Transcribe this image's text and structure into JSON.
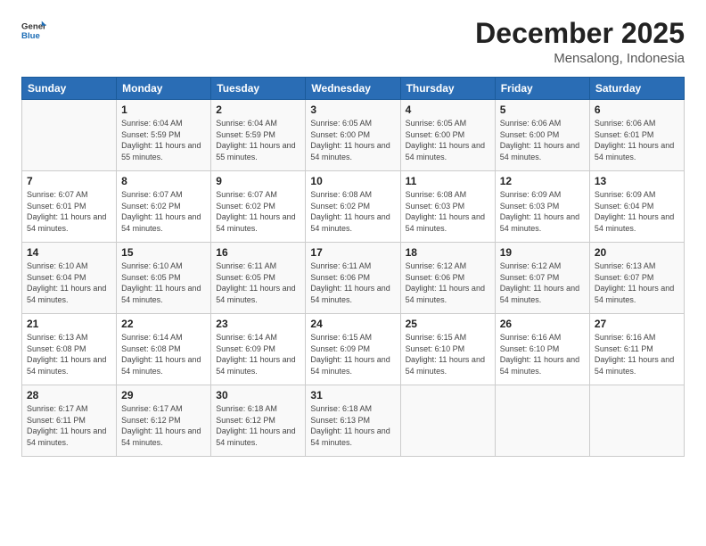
{
  "header": {
    "logo_line1": "General",
    "logo_line2": "Blue",
    "month_year": "December 2025",
    "location": "Mensalong, Indonesia"
  },
  "days_of_week": [
    "Sunday",
    "Monday",
    "Tuesday",
    "Wednesday",
    "Thursday",
    "Friday",
    "Saturday"
  ],
  "weeks": [
    [
      {
        "day": "",
        "sunrise": "",
        "sunset": "",
        "daylight": ""
      },
      {
        "day": "1",
        "sunrise": "Sunrise: 6:04 AM",
        "sunset": "Sunset: 5:59 PM",
        "daylight": "Daylight: 11 hours and 55 minutes."
      },
      {
        "day": "2",
        "sunrise": "Sunrise: 6:04 AM",
        "sunset": "Sunset: 5:59 PM",
        "daylight": "Daylight: 11 hours and 55 minutes."
      },
      {
        "day": "3",
        "sunrise": "Sunrise: 6:05 AM",
        "sunset": "Sunset: 6:00 PM",
        "daylight": "Daylight: 11 hours and 54 minutes."
      },
      {
        "day": "4",
        "sunrise": "Sunrise: 6:05 AM",
        "sunset": "Sunset: 6:00 PM",
        "daylight": "Daylight: 11 hours and 54 minutes."
      },
      {
        "day": "5",
        "sunrise": "Sunrise: 6:06 AM",
        "sunset": "Sunset: 6:00 PM",
        "daylight": "Daylight: 11 hours and 54 minutes."
      },
      {
        "day": "6",
        "sunrise": "Sunrise: 6:06 AM",
        "sunset": "Sunset: 6:01 PM",
        "daylight": "Daylight: 11 hours and 54 minutes."
      }
    ],
    [
      {
        "day": "7",
        "sunrise": "Sunrise: 6:07 AM",
        "sunset": "Sunset: 6:01 PM",
        "daylight": "Daylight: 11 hours and 54 minutes."
      },
      {
        "day": "8",
        "sunrise": "Sunrise: 6:07 AM",
        "sunset": "Sunset: 6:02 PM",
        "daylight": "Daylight: 11 hours and 54 minutes."
      },
      {
        "day": "9",
        "sunrise": "Sunrise: 6:07 AM",
        "sunset": "Sunset: 6:02 PM",
        "daylight": "Daylight: 11 hours and 54 minutes."
      },
      {
        "day": "10",
        "sunrise": "Sunrise: 6:08 AM",
        "sunset": "Sunset: 6:02 PM",
        "daylight": "Daylight: 11 hours and 54 minutes."
      },
      {
        "day": "11",
        "sunrise": "Sunrise: 6:08 AM",
        "sunset": "Sunset: 6:03 PM",
        "daylight": "Daylight: 11 hours and 54 minutes."
      },
      {
        "day": "12",
        "sunrise": "Sunrise: 6:09 AM",
        "sunset": "Sunset: 6:03 PM",
        "daylight": "Daylight: 11 hours and 54 minutes."
      },
      {
        "day": "13",
        "sunrise": "Sunrise: 6:09 AM",
        "sunset": "Sunset: 6:04 PM",
        "daylight": "Daylight: 11 hours and 54 minutes."
      }
    ],
    [
      {
        "day": "14",
        "sunrise": "Sunrise: 6:10 AM",
        "sunset": "Sunset: 6:04 PM",
        "daylight": "Daylight: 11 hours and 54 minutes."
      },
      {
        "day": "15",
        "sunrise": "Sunrise: 6:10 AM",
        "sunset": "Sunset: 6:05 PM",
        "daylight": "Daylight: 11 hours and 54 minutes."
      },
      {
        "day": "16",
        "sunrise": "Sunrise: 6:11 AM",
        "sunset": "Sunset: 6:05 PM",
        "daylight": "Daylight: 11 hours and 54 minutes."
      },
      {
        "day": "17",
        "sunrise": "Sunrise: 6:11 AM",
        "sunset": "Sunset: 6:06 PM",
        "daylight": "Daylight: 11 hours and 54 minutes."
      },
      {
        "day": "18",
        "sunrise": "Sunrise: 6:12 AM",
        "sunset": "Sunset: 6:06 PM",
        "daylight": "Daylight: 11 hours and 54 minutes."
      },
      {
        "day": "19",
        "sunrise": "Sunrise: 6:12 AM",
        "sunset": "Sunset: 6:07 PM",
        "daylight": "Daylight: 11 hours and 54 minutes."
      },
      {
        "day": "20",
        "sunrise": "Sunrise: 6:13 AM",
        "sunset": "Sunset: 6:07 PM",
        "daylight": "Daylight: 11 hours and 54 minutes."
      }
    ],
    [
      {
        "day": "21",
        "sunrise": "Sunrise: 6:13 AM",
        "sunset": "Sunset: 6:08 PM",
        "daylight": "Daylight: 11 hours and 54 minutes."
      },
      {
        "day": "22",
        "sunrise": "Sunrise: 6:14 AM",
        "sunset": "Sunset: 6:08 PM",
        "daylight": "Daylight: 11 hours and 54 minutes."
      },
      {
        "day": "23",
        "sunrise": "Sunrise: 6:14 AM",
        "sunset": "Sunset: 6:09 PM",
        "daylight": "Daylight: 11 hours and 54 minutes."
      },
      {
        "day": "24",
        "sunrise": "Sunrise: 6:15 AM",
        "sunset": "Sunset: 6:09 PM",
        "daylight": "Daylight: 11 hours and 54 minutes."
      },
      {
        "day": "25",
        "sunrise": "Sunrise: 6:15 AM",
        "sunset": "Sunset: 6:10 PM",
        "daylight": "Daylight: 11 hours and 54 minutes."
      },
      {
        "day": "26",
        "sunrise": "Sunrise: 6:16 AM",
        "sunset": "Sunset: 6:10 PM",
        "daylight": "Daylight: 11 hours and 54 minutes."
      },
      {
        "day": "27",
        "sunrise": "Sunrise: 6:16 AM",
        "sunset": "Sunset: 6:11 PM",
        "daylight": "Daylight: 11 hours and 54 minutes."
      }
    ],
    [
      {
        "day": "28",
        "sunrise": "Sunrise: 6:17 AM",
        "sunset": "Sunset: 6:11 PM",
        "daylight": "Daylight: 11 hours and 54 minutes."
      },
      {
        "day": "29",
        "sunrise": "Sunrise: 6:17 AM",
        "sunset": "Sunset: 6:12 PM",
        "daylight": "Daylight: 11 hours and 54 minutes."
      },
      {
        "day": "30",
        "sunrise": "Sunrise: 6:18 AM",
        "sunset": "Sunset: 6:12 PM",
        "daylight": "Daylight: 11 hours and 54 minutes."
      },
      {
        "day": "31",
        "sunrise": "Sunrise: 6:18 AM",
        "sunset": "Sunset: 6:13 PM",
        "daylight": "Daylight: 11 hours and 54 minutes."
      },
      {
        "day": "",
        "sunrise": "",
        "sunset": "",
        "daylight": ""
      },
      {
        "day": "",
        "sunrise": "",
        "sunset": "",
        "daylight": ""
      },
      {
        "day": "",
        "sunrise": "",
        "sunset": "",
        "daylight": ""
      }
    ]
  ]
}
